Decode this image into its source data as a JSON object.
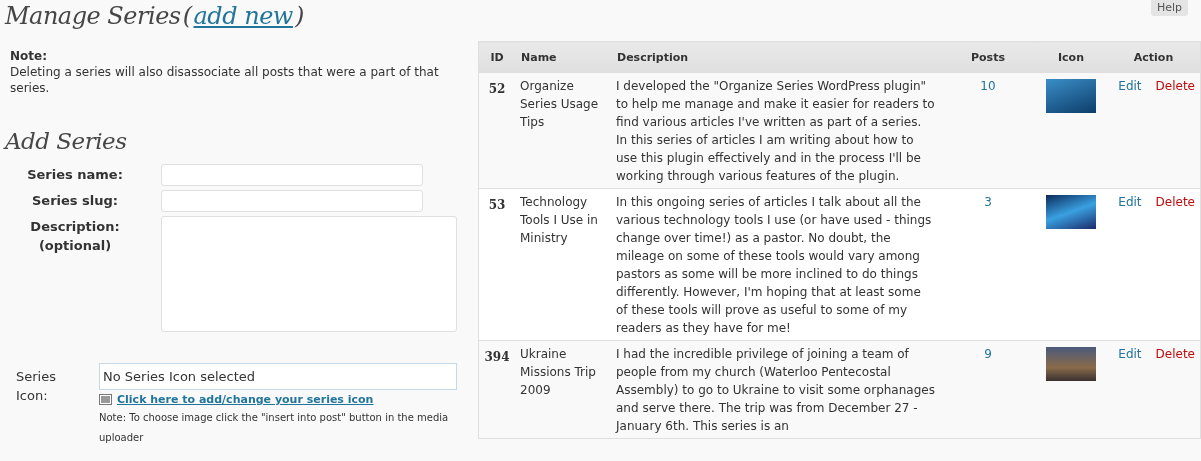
{
  "help_button": {
    "label": "Help"
  },
  "heading": {
    "title": "Manage Series",
    "open": "(",
    "link": "add new",
    "close": ")"
  },
  "note": {
    "label": "Note:",
    "text": "Deleting a series will also disassociate all posts that were a part of that series."
  },
  "add_series": {
    "title": "Add Series",
    "fields": [
      {
        "kind": "text",
        "label": "Series name:"
      },
      {
        "kind": "text",
        "label": "Series slug:"
      },
      {
        "kind": "textarea",
        "label": "Description: (optional)"
      }
    ],
    "icon_field": {
      "label": "Series Icon:",
      "value": "No Series Icon selected",
      "link": "Click here to add/change your series icon",
      "note": "Note: To choose image click the \"insert into post\" button in the media uploader"
    }
  },
  "table": {
    "columns": [
      "ID",
      "Name",
      "Description",
      "Posts",
      "Icon",
      "Action"
    ],
    "rows": [
      {
        "id": "52",
        "name": "Organize Series Usage Tips",
        "description": "I developed the \"Organize Series WordPress plugin\" to help me manage and make it easier for readers to find various articles I've written as part of a series. In this series of articles I am writing about how to use this plugin effectively and in the process I'll be working through various features of the plugin.",
        "posts": "10",
        "edit": "Edit",
        "delete": "Delete"
      },
      {
        "id": "53",
        "name": "Technology Tools I Use in Ministry",
        "description": "In this ongoing series of articles I talk about all the various technology tools I use (or have used - things change over time!) as a pastor. No doubt, the mileage on some of these tools would vary among pastors as some will be more inclined to do things differently. However, I'm hoping that at least some of these tools will prove as useful to some of my readers as they have for me!",
        "posts": "3",
        "edit": "Edit",
        "delete": "Delete"
      },
      {
        "id": "394",
        "name": "Ukraine Missions Trip 2009",
        "description": "I had the incredible privilege of joining a team of people from my church (Waterloo Pentecostal Assembly) to go to Ukraine to visit some orphanages and serve there. The trip was from December 27 - January 6th. This series is an",
        "posts": "9",
        "edit": "Edit",
        "delete": "Delete"
      }
    ]
  }
}
